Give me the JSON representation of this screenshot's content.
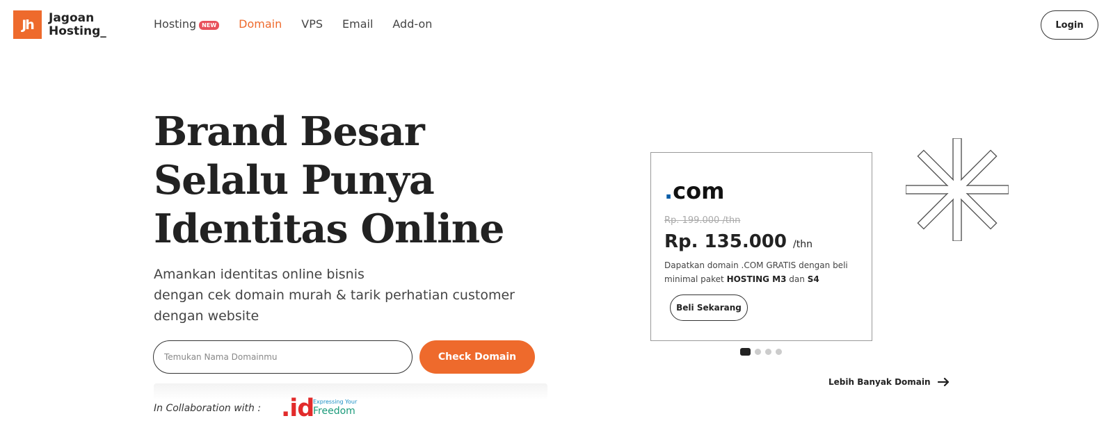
{
  "brand": {
    "logo_mark": "Jh",
    "name_line1": "Jagoan",
    "name_line2": "Hosting_"
  },
  "nav": {
    "items": [
      {
        "label": "Hosting",
        "badge": "NEW"
      },
      {
        "label": "Domain"
      },
      {
        "label": "VPS"
      },
      {
        "label": "Email"
      },
      {
        "label": "Add-on"
      }
    ],
    "active": "Domain",
    "login_label": "Login"
  },
  "hero": {
    "headline_lines": [
      "Brand Besar",
      "Selalu Punya",
      "Identitas Online"
    ],
    "sub_lines": [
      "Amankan identitas online bisnis",
      "dengan cek domain murah & tarik perhatian customer",
      "dengan website"
    ],
    "search_placeholder": "Temukan Nama Domainmu",
    "check_label": "Check Domain",
    "collab_label": "In Collaboration with :",
    "partner_logo_text": ".id",
    "partner_tagline": "Expressing Your",
    "partner_word": "Freedom"
  },
  "promo": {
    "ext_dot": ".",
    "ext_name": "com",
    "old_price": "Rp. 199.000 /thn",
    "price": "Rp. 135.000",
    "price_unit": "/thn",
    "desc_part1": "Dapatkan domain .COM GRATIS dengan beli minimal paket ",
    "desc_bold1": "HOSTING M3",
    "desc_part2": " dan ",
    "desc_bold2": "S4",
    "button_label": "Beli Sekarang",
    "slides_total": 4,
    "slide_active": 1
  },
  "more_link": "Lebih Banyak Domain",
  "colors": {
    "accent": "#ee6a2c",
    "text": "#222222",
    "dot_blue": "#0b5ea8"
  },
  "icons": [
    "logo-mark-icon",
    "arrow-right-icon",
    "asterisk-star-icon"
  ]
}
